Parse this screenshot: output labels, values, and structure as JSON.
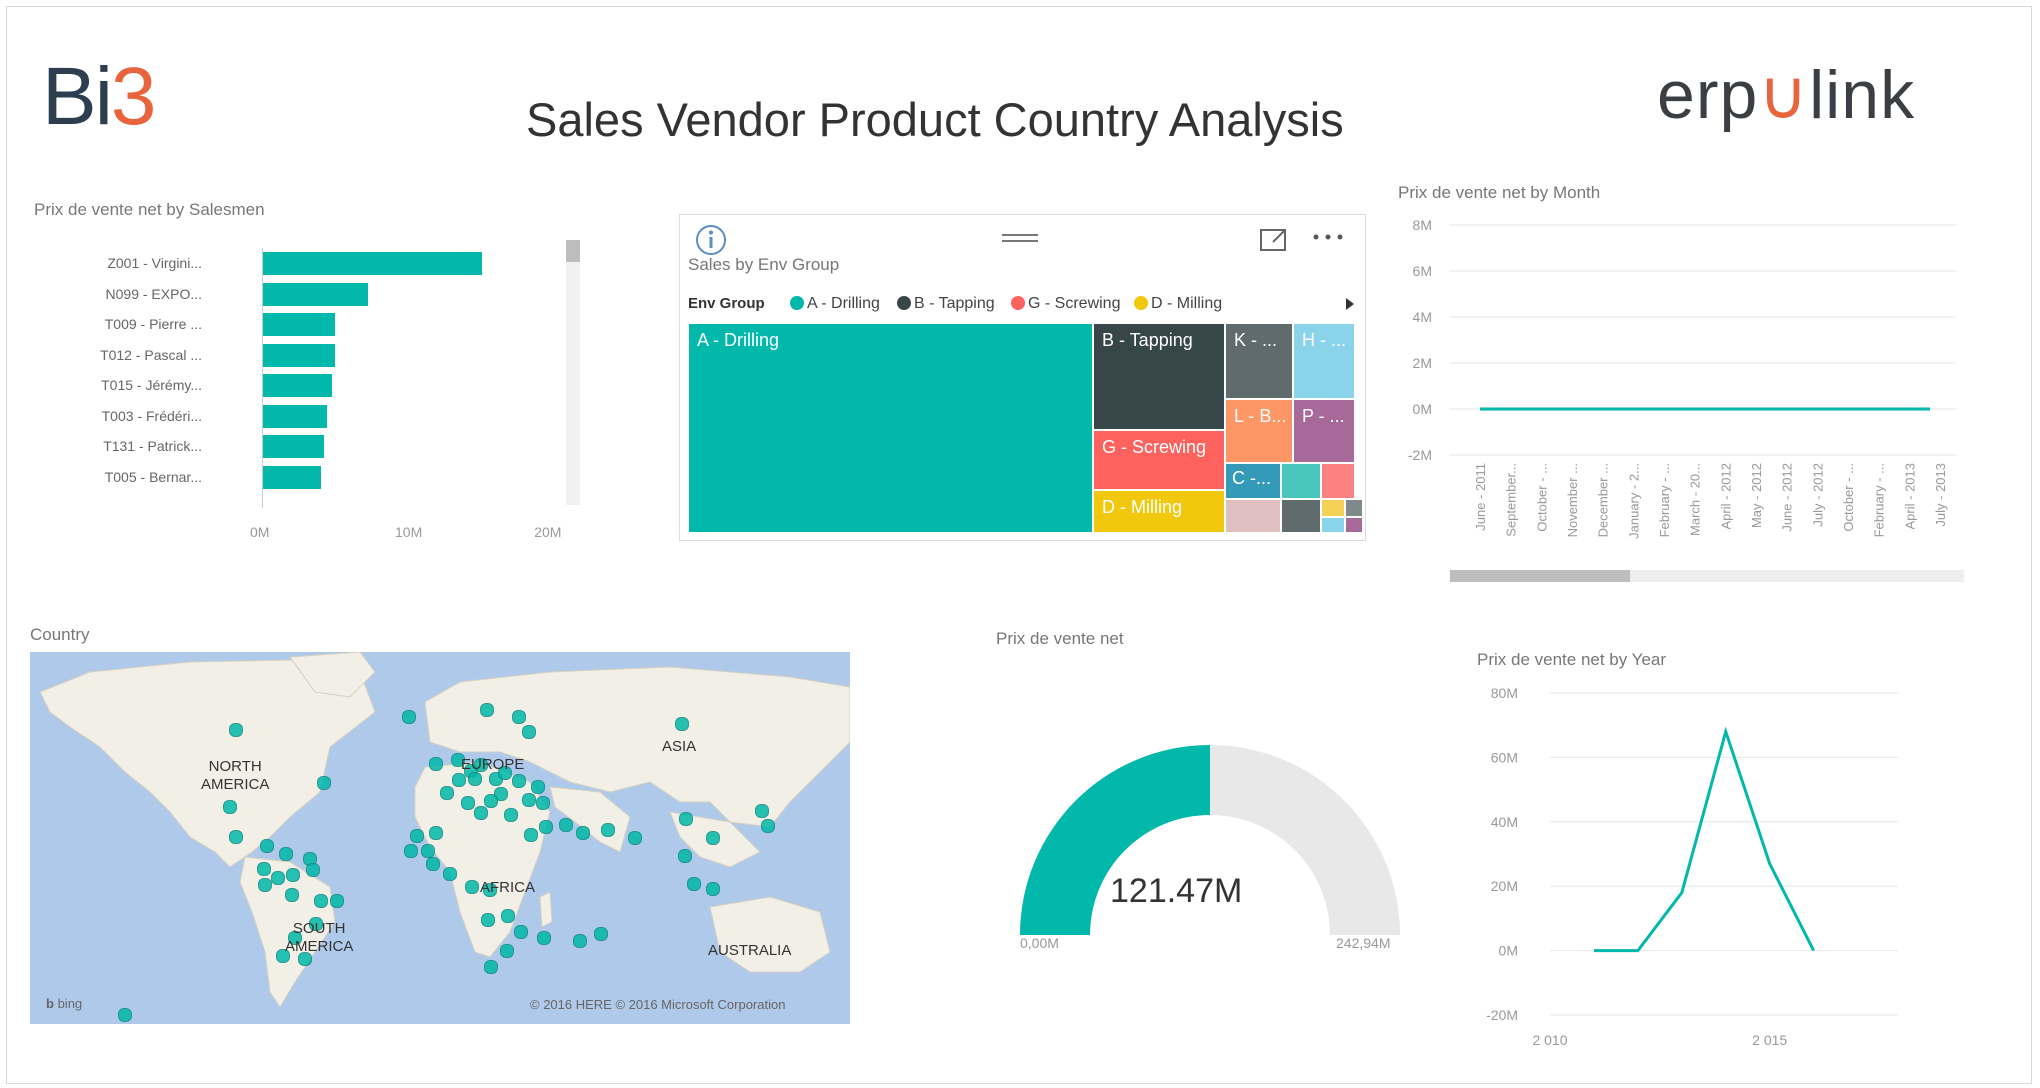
{
  "header": {
    "logo_left_bi": "Bi",
    "logo_left_3": "3",
    "title": "Sales Vendor Product Country  Analysis",
    "logo_right_a": "erp",
    "logo_right_u": "∪",
    "logo_right_b": "link"
  },
  "salesmen": {
    "title": "Prix de vente net by Salesmen",
    "rows": [
      {
        "label": "Z001 - Virgini...",
        "value": 15.2
      },
      {
        "label": "N099 - EXPO...",
        "value": 7.3
      },
      {
        "label": "T009 - Pierre ...",
        "value": 5.0
      },
      {
        "label": "T012 - Pascal ...",
        "value": 5.0
      },
      {
        "label": "T015 - Jérémy...",
        "value": 4.8
      },
      {
        "label": "T003 - Frédéri...",
        "value": 4.5
      },
      {
        "label": "T131 - Patrick...",
        "value": 4.3
      },
      {
        "label": "T005 - Bernar...",
        "value": 4.1
      }
    ],
    "axis_ticks": [
      "0M",
      "10M",
      "20M"
    ],
    "xlim": [
      0,
      20
    ]
  },
  "treemap": {
    "title": "Sales by  Env Group",
    "legend_title": "Env Group",
    "legend": [
      {
        "label": "A - Drilling",
        "color": "#01b8aa"
      },
      {
        "label": "B - Tapping",
        "color": "#374649"
      },
      {
        "label": "G - Screwing",
        "color": "#fd625e"
      },
      {
        "label": "D - Milling",
        "color": "#f2c80f"
      }
    ],
    "cells": {
      "a": "A - Drilling",
      "b": "B - Tapping",
      "g": "G - Screwing",
      "d": "D - Milling",
      "k": "K - ...",
      "h": "H - ...",
      "l": "L - B...",
      "p": "P - ...",
      "c": "C -..."
    }
  },
  "month": {
    "title": "Prix de vente net by Month",
    "y_ticks": [
      "8M",
      "6M",
      "4M",
      "2M",
      "0M",
      "-2M"
    ],
    "x_labels": [
      "June - 2011",
      "September...",
      "October - ...",
      "November ...",
      "December ...",
      "January - 2...",
      "February - ...",
      "March - 20...",
      "April - 2012",
      "May - 2012",
      "June - 2012",
      "July - 2012",
      "October - ...",
      "February - ...",
      "April - 2013",
      "July - 2013"
    ]
  },
  "country": {
    "title": "Country",
    "labels": [
      "NORTH",
      "AMERICA",
      "EUROPE",
      "ASIA",
      "AFRICA",
      "SOUTH",
      "AMERICA",
      "AUSTRALIA"
    ],
    "bing": "bing",
    "copyright": "© 2016 HERE    © 2016 Microsoft Corporation"
  },
  "gauge": {
    "title": "Prix de vente net",
    "value_label": "121.47M",
    "min_label": "0,00M",
    "max_label": "242,94M",
    "value": 121.47,
    "max": 242.94
  },
  "year": {
    "title": "Prix de vente net by Year",
    "y_ticks": [
      "80M",
      "60M",
      "40M",
      "20M",
      "0M",
      "-20M"
    ],
    "x_ticks": [
      "2 010",
      "2 015"
    ]
  },
  "chart_data": [
    {
      "type": "bar",
      "title": "Prix de vente net by Salesmen",
      "categories": [
        "Z001 - Virgini...",
        "N099 - EXPO...",
        "T009 - Pierre ...",
        "T012 - Pascal ...",
        "T015 - Jérémy...",
        "T003 - Frédéri...",
        "T131 - Patrick...",
        "T005 - Bernar..."
      ],
      "values": [
        15.2,
        7.3,
        5.0,
        5.0,
        4.8,
        4.5,
        4.3,
        4.1
      ],
      "xlim": [
        0,
        20
      ]
    },
    {
      "type": "line",
      "title": "Prix de vente net by Month",
      "x": [
        "June - 2011",
        "July - 2013"
      ],
      "values": [
        0,
        0
      ],
      "ylim": [
        -2,
        8
      ]
    },
    {
      "type": "line",
      "title": "Prix de vente net by Year",
      "x": [
        2011,
        2012,
        2013,
        2014,
        2015,
        2016
      ],
      "values": [
        0,
        0,
        18,
        68,
        27,
        0
      ],
      "ylim": [
        -20,
        80
      ]
    }
  ]
}
